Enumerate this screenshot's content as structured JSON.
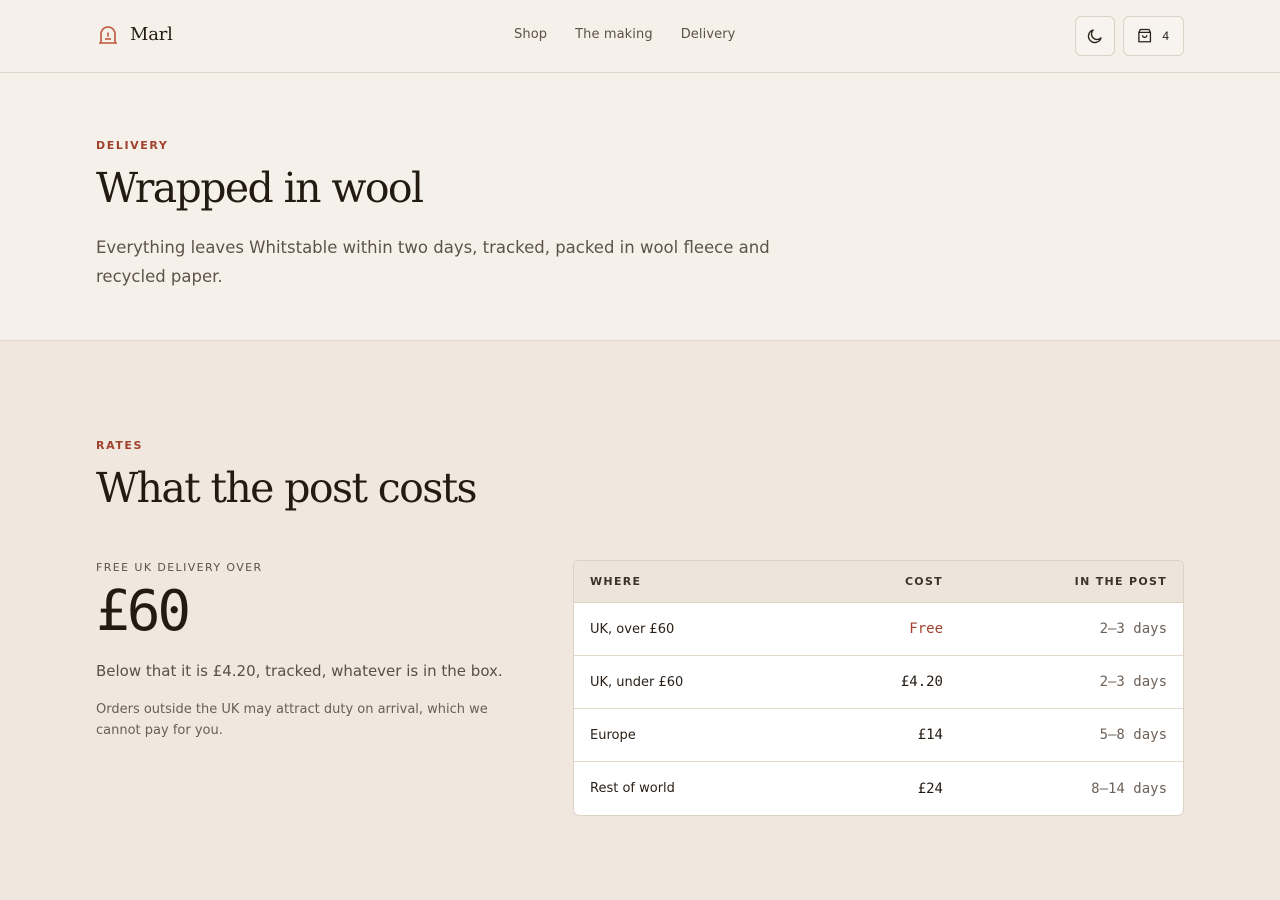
{
  "header": {
    "brand": "Marl",
    "nav": [
      "Shop",
      "The making",
      "Delivery"
    ],
    "cart_count": "4",
    "icons": {
      "brand": "dome-logo-icon",
      "theme": "moon-icon",
      "cart": "shopping-bag-icon"
    }
  },
  "hero": {
    "eyebrow": "Delivery",
    "title": "Wrapped in wool",
    "text": "Everything leaves Whitstable within two days, tracked, packed in wool fleece and recycled paper."
  },
  "rates": {
    "eyebrow": "Rates",
    "title": "What the post costs",
    "free_label": "Free UK delivery over",
    "amount": "£60",
    "below": "Below that it is £4.20, tracked, whatever is in the box.",
    "note": "Orders outside the UK may attract duty on arrival, which we cannot pay for you."
  },
  "table": {
    "headers": [
      "Where",
      "Cost",
      "In the post"
    ],
    "rows": [
      {
        "where": "UK, over £60",
        "cost": "Free",
        "time": "2–3 days"
      },
      {
        "where": "UK, under £60",
        "cost": "£4.20",
        "time": "2–3 days"
      },
      {
        "where": "Europe",
        "cost": "£14",
        "time": "5–8 days"
      },
      {
        "where": "Rest of world",
        "cost": "£24",
        "time": "8–14 days"
      }
    ]
  },
  "colors": {
    "accent": "#a0412c",
    "page": "#f0e8df",
    "header_bg": "#f5f0ea",
    "ink": "#231a12"
  }
}
